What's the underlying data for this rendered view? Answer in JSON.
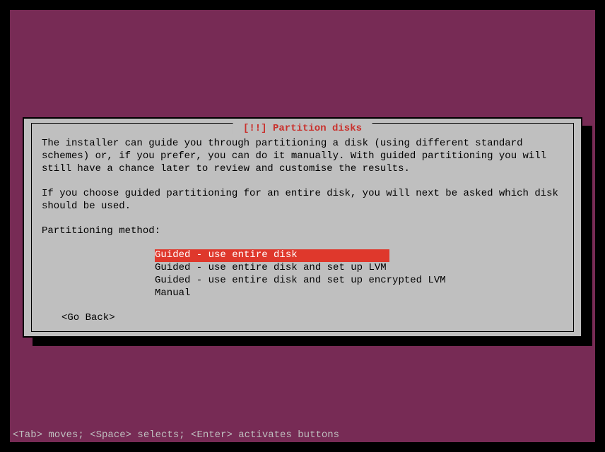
{
  "dialog": {
    "title": " [!!] Partition disks ",
    "paragraph1": "The installer can guide you through partitioning a disk (using different standard schemes) or, if you prefer, you can do it manually. With guided partitioning you will still have a chance later to review and customise the results.",
    "paragraph2": "If you choose guided partitioning for an entire disk, you will next be asked which disk should be used.",
    "method_label": "Partitioning method:",
    "options": [
      "Guided - use entire disk",
      "Guided - use entire disk and set up LVM",
      "Guided - use entire disk and set up encrypted LVM",
      "Manual"
    ],
    "go_back": "<Go Back>"
  },
  "footer": "<Tab> moves; <Space> selects; <Enter> activates buttons"
}
